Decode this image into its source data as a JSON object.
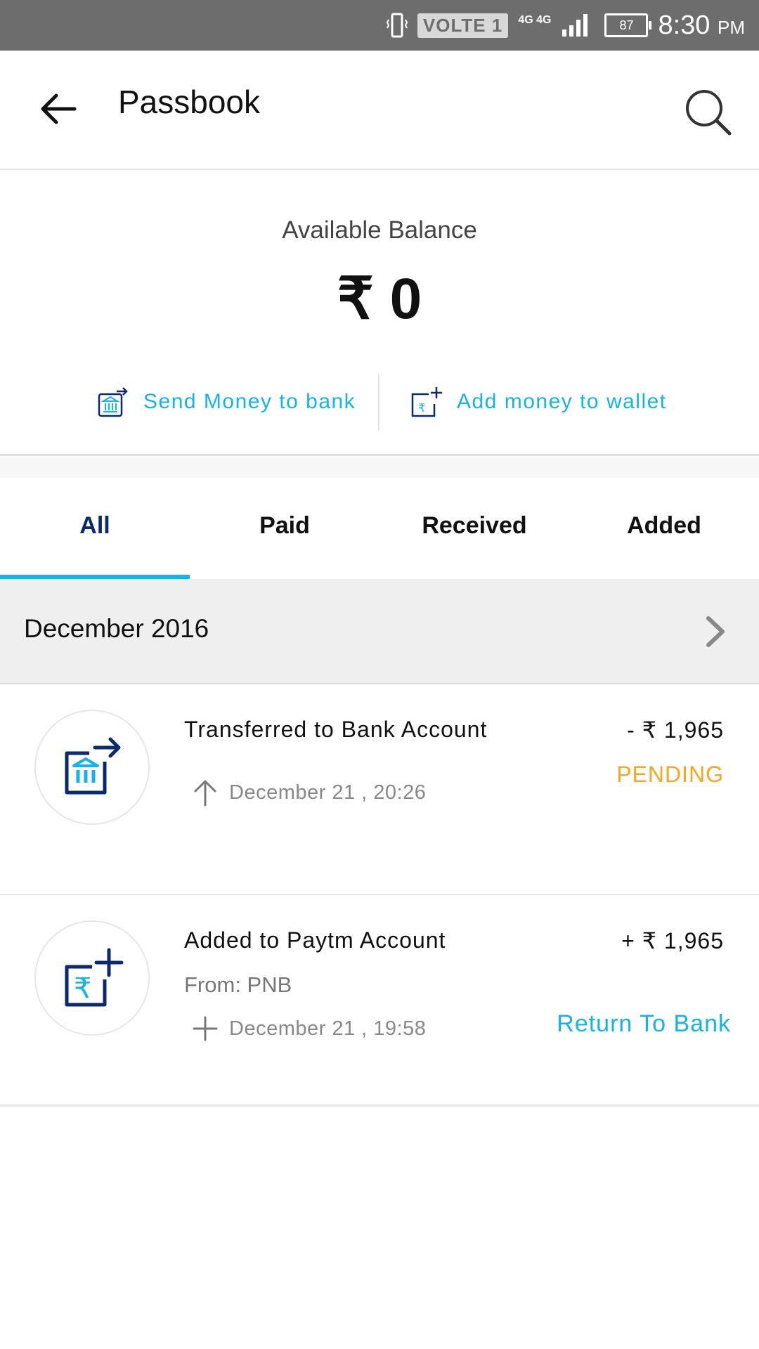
{
  "status_bar": {
    "volte": "VOLTE 1",
    "network": "4G 4G",
    "sim_slot": "1",
    "battery": "87",
    "time": "8:30",
    "ampm": "PM"
  },
  "app_bar": {
    "title": "Passbook"
  },
  "balance": {
    "label": "Available Balance",
    "amount": "₹ 0"
  },
  "actions": {
    "send": "Send Money to bank",
    "add": "Add money to wallet"
  },
  "tabs": [
    {
      "label": "All",
      "active": true
    },
    {
      "label": "Paid",
      "active": false
    },
    {
      "label": "Received",
      "active": false
    },
    {
      "label": "Added",
      "active": false
    }
  ],
  "month": {
    "label": "December 2016"
  },
  "transactions": [
    {
      "title": "Transferred to Bank Account",
      "amount": "- ₹ 1,965",
      "status": "PENDING",
      "date": "December 21 , 20:26",
      "icon": "bank-transfer-icon"
    },
    {
      "title": "Added to Paytm Account",
      "subtitle": "From: PNB",
      "amount": "+ ₹ 1,965",
      "date": "December 21 , 19:58",
      "action": "Return To Bank",
      "icon": "add-money-icon"
    }
  ],
  "colors": {
    "accent": "#16b3e6",
    "pending": "#f5a623",
    "navy": "#0b2a6b",
    "status_bar": "#6d6d6d"
  }
}
